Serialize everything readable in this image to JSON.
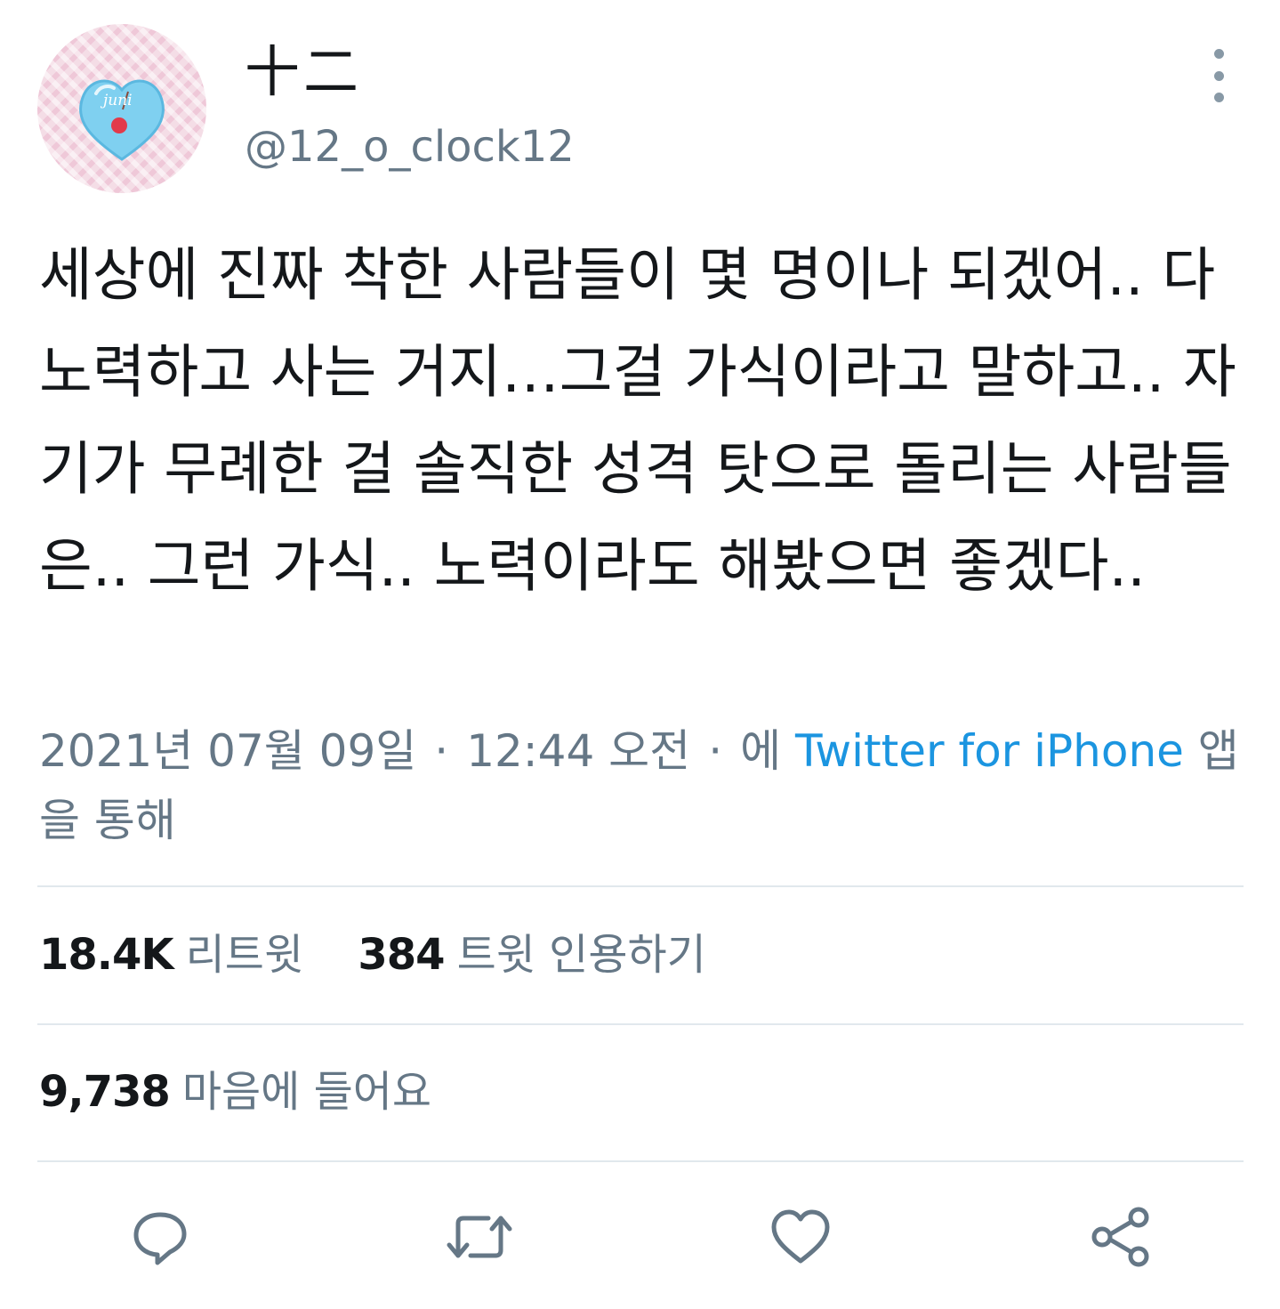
{
  "author": {
    "display_name": "十二",
    "handle": "@12_o_clock12",
    "avatar_text": "juni"
  },
  "tweet": {
    "text": "세상에 진짜 착한 사람들이 몇 명이나 되겠어.. 다 노력하고 사는 거지…그걸 가식이라고 말하고.. 자기가 무례한 걸 솔직한 성격 탓으로 돌리는 사람들은.. 그런 가식.. 노력이라도 해봤으면 좋겠다..",
    "date": "2021년 07월 09일",
    "time": "12:44 오전",
    "via_prefix": "에",
    "source": "Twitter for iPhone",
    "via_suffix": "앱을 통해"
  },
  "stats": {
    "retweets": "18.4K",
    "retweets_label": "리트윗",
    "quotes": "384",
    "quotes_label": "트윗 인용하기",
    "likes": "9,738",
    "likes_label": "마음에 들어요"
  },
  "colors": {
    "text": "#14171a",
    "secondary": "#657786",
    "link": "#1b95e0",
    "icon": "#657786",
    "divider": "#e1e8ed"
  },
  "icons": [
    "more-icon",
    "reply-icon",
    "retweet-icon",
    "like-icon",
    "share-icon"
  ]
}
